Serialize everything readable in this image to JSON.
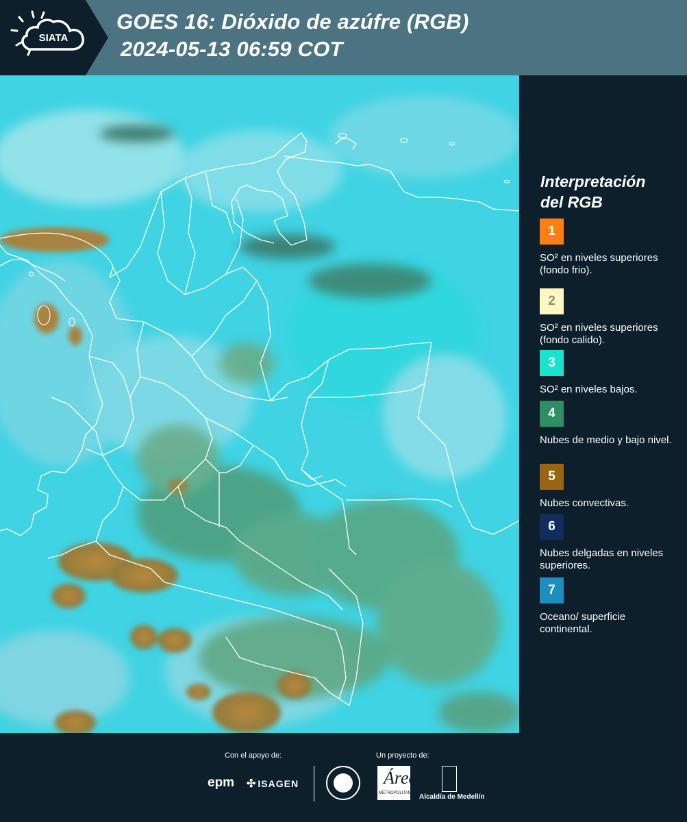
{
  "header": {
    "logo_text": "SIATA",
    "title_line1": "GOES 16: Dióxido de azúfre (RGB)",
    "title_line2": "2024-05-13 06:59 COT",
    "background": "#4c7382"
  },
  "map": {
    "product": "SO2 RGB",
    "ocean_color": "#1ec2dd",
    "land_color": "#5cd7e0",
    "cloud_mid_color": "#4f9a78",
    "cloud_convective_color": "#a07a3a"
  },
  "legend": {
    "title_line1": "Interpretación",
    "title_line2": "del RGB",
    "items": [
      {
        "number": "1",
        "color": "#ff7f0e",
        "label": "SO² en niveles superiores (fondo frio)."
      },
      {
        "number": "2",
        "color": "#fff7c2",
        "label": "SO² en niveles superiores (fondo calido)."
      },
      {
        "number": "3",
        "color": "#19e3cf",
        "label": "SO² en niveles bajos."
      },
      {
        "number": "4",
        "color": "#2f8f63",
        "label": "Nubes de medio y bajo nivel."
      },
      {
        "number": "5",
        "color": "#996510",
        "label": "Nubes convectivas."
      },
      {
        "number": "6",
        "color": "#0f2d5e",
        "label": "Nubes delgadas en niveles superiores."
      },
      {
        "number": "7",
        "color": "#1c8fc0",
        "label": "Oceano/ superficie continental."
      }
    ]
  },
  "footer": {
    "support_caption": "Con el apoyo de:",
    "project_caption": "Un proyecto de:",
    "epm_logo": "epm",
    "isagen_logo": "ISAGEN",
    "area_logo": "Área",
    "area_logo_sub": "METROPOLITANA",
    "alcaldia_logo": "Alcaldía de Medellín"
  }
}
